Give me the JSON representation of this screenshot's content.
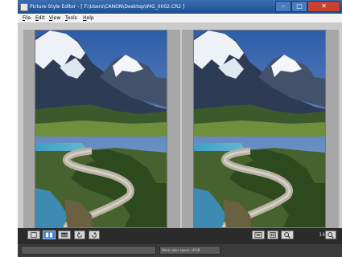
{
  "window": {
    "title": "Picture Style Editor - [ F:\\Users\\CANON\\Desktop\\IMG_0002.CR2 ]",
    "controls": {
      "minimize": "–",
      "maximize": "□",
      "close": "✕"
    }
  },
  "menu": {
    "items": [
      "File",
      "Edit",
      "View",
      "Tools",
      "Help"
    ]
  },
  "toolbar": {
    "zoom": "14.6%",
    "icons": [
      "single-view-icon",
      "split-view-icon",
      "compare-view-icon",
      "rotate-left-icon",
      "rotate-right-icon",
      "fit-window-icon",
      "full-screen-icon",
      "zoom-icon",
      "zoom-100-icon"
    ]
  },
  "status": {
    "color_space": "Work color space: sRGB"
  },
  "colors": {
    "accent": "#3c7fd1",
    "titlebar": "#1c4f92",
    "close": "#c8432f",
    "toolbar": "#2b2b2b"
  }
}
